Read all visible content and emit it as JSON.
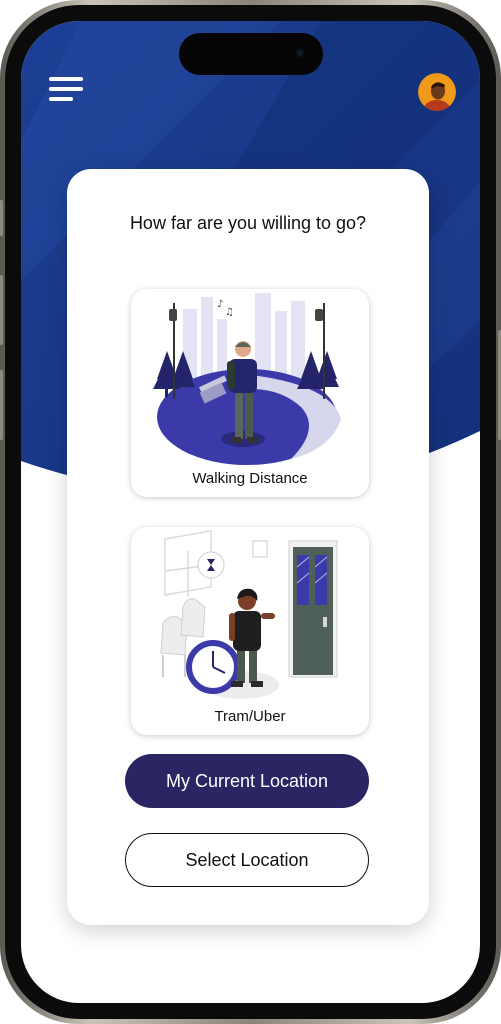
{
  "header": {
    "menu_icon": "hamburger-menu-icon",
    "avatar_icon": "user-avatar"
  },
  "card": {
    "question": "How far are you willing to go?"
  },
  "options": [
    {
      "label": "Walking Distance",
      "illustration": "walking-person-park-illustration"
    },
    {
      "label": "Tram/Uber",
      "illustration": "waiting-person-clock-door-illustration"
    }
  ],
  "actions": {
    "current_location_label": "My Current Location",
    "select_location_label": "Select Location"
  },
  "colors": {
    "hero_blue": "#1b3a8c",
    "primary_button": "#2a2563",
    "illustration_accent": "#3b3aa8",
    "avatar_bg": "#f19a1a"
  }
}
